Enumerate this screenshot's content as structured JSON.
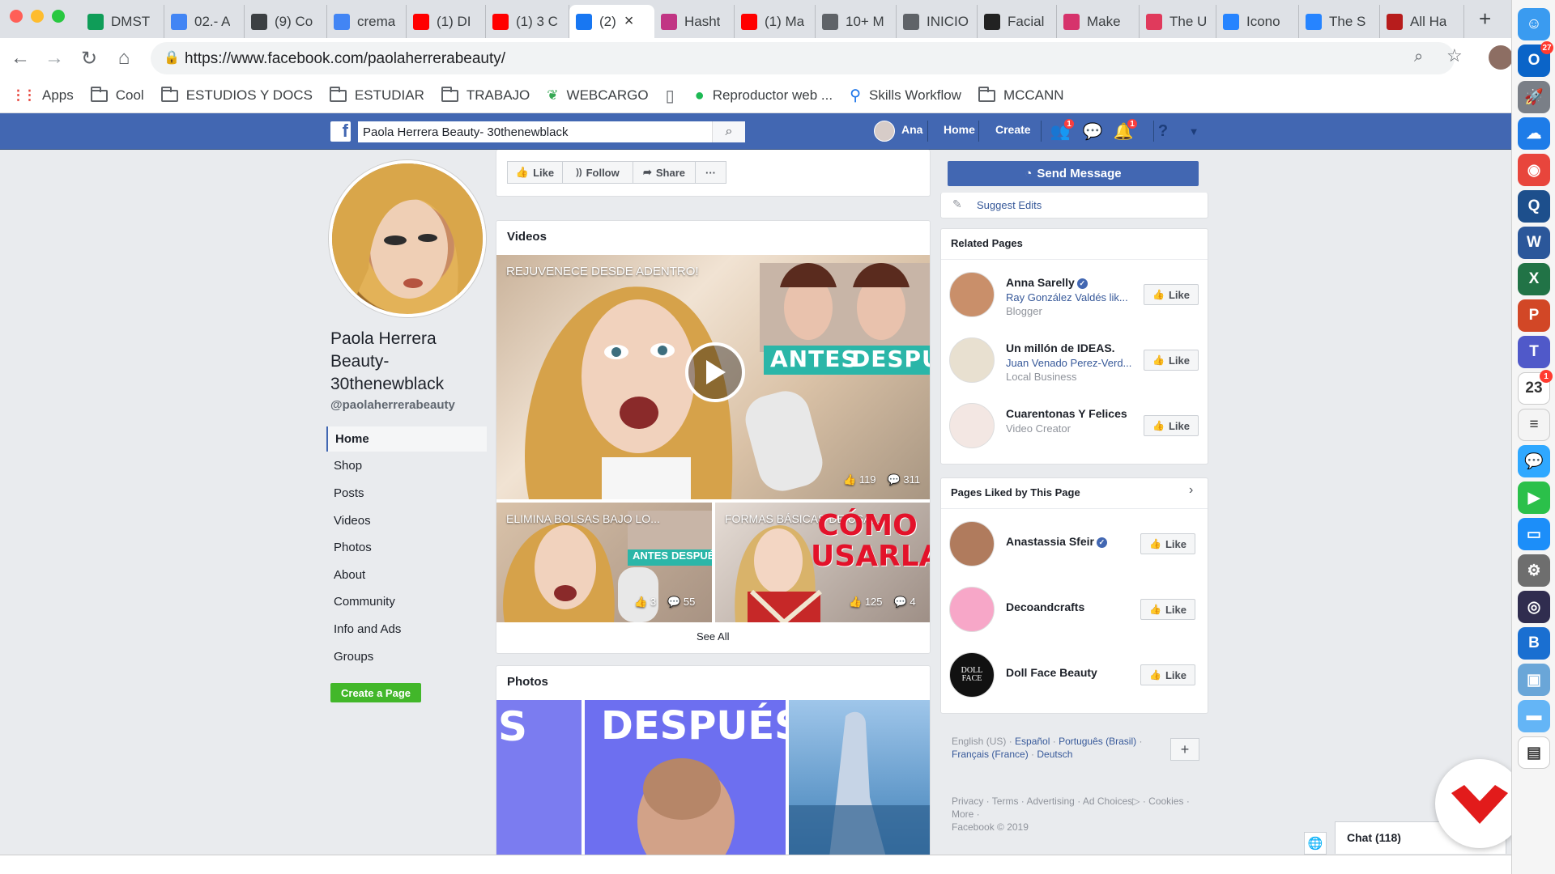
{
  "browser": {
    "tabs": [
      {
        "title": "DMST",
        "favicon": "sheets-icon",
        "color": "#0f9d58"
      },
      {
        "title": "02.- A",
        "favicon": "docs-icon",
        "color": "#4285f4"
      },
      {
        "title": "(9) Co",
        "favicon": "wordpress-icon",
        "color": "#3c4043"
      },
      {
        "title": "crema",
        "favicon": "google-icon",
        "color": "#4285f4"
      },
      {
        "title": "(1) DI",
        "favicon": "youtube-icon",
        "color": "#ff0000"
      },
      {
        "title": "(1) 3 C",
        "favicon": "youtube-icon",
        "color": "#ff0000"
      },
      {
        "title": "(2)",
        "favicon": "facebook-icon",
        "color": "#1877f2",
        "active": true
      },
      {
        "title": "Hasht",
        "favicon": "instagram-icon",
        "color": "#c13584"
      },
      {
        "title": "(1) Ma",
        "favicon": "youtube-icon",
        "color": "#ff0000"
      },
      {
        "title": "10+ M",
        "favicon": "image-icon",
        "color": "#5f6368"
      },
      {
        "title": "INICIO",
        "favicon": "page-icon",
        "color": "#5f6368"
      },
      {
        "title": "Facial",
        "favicon": "tb-icon",
        "color": "#222222"
      },
      {
        "title": "Make",
        "favicon": "makeup-icon",
        "color": "#d6336c"
      },
      {
        "title": "The U",
        "favicon": "bookmark-icon",
        "color": "#e03a5c"
      },
      {
        "title": "Icono",
        "favicon": "jira-icon",
        "color": "#2684ff"
      },
      {
        "title": "The S",
        "favicon": "jira-icon",
        "color": "#2684ff"
      },
      {
        "title": "All Ha",
        "favicon": "hashtag-icon",
        "color": "#b71c1c"
      }
    ],
    "url": "https://www.facebook.com/paolaherrerabeauty/",
    "bookmarks": [
      {
        "label": "Apps",
        "type": "apps"
      },
      {
        "label": "Cool",
        "type": "folder"
      },
      {
        "label": "ESTUDIOS Y DOCS",
        "type": "folder"
      },
      {
        "label": "ESTUDIAR",
        "type": "folder"
      },
      {
        "label": "TRABAJO",
        "type": "folder"
      },
      {
        "label": "WEBCARGO",
        "type": "leaf"
      },
      {
        "label": "",
        "type": "page"
      },
      {
        "label": "Reproductor web ...",
        "type": "spotify"
      },
      {
        "label": "Skills Workflow",
        "type": "pin"
      },
      {
        "label": "MCCANN",
        "type": "folder"
      }
    ]
  },
  "fb_header": {
    "search_value": "Paola Herrera Beauty- 30thenewblack",
    "user_name": "Ana",
    "home": "Home",
    "create": "Create",
    "friend_badge": "1",
    "notif_badge": "1"
  },
  "profile": {
    "name": "Paola Herrera Beauty- 30thenewblack",
    "handle": "@paolaherrerabeauty",
    "nav": [
      "Home",
      "Shop",
      "Posts",
      "Videos",
      "Photos",
      "About",
      "Community",
      "Info and Ads",
      "Groups"
    ],
    "create_page": "Create a Page"
  },
  "actions": {
    "like": "Like",
    "follow": "Follow",
    "share": "Share",
    "more": "···",
    "send_message": "Send Message",
    "suggest_edits": "Suggest Edits"
  },
  "videos": {
    "title": "Videos",
    "main": {
      "title": "REJUVENECE DESDE ADENTRO!",
      "overlay_antes": "ANTES",
      "overlay_despues": "DESPUÉS",
      "likes": "119",
      "comments": "311"
    },
    "small": [
      {
        "title": "ELIMINA BOLSAS BAJO LO...",
        "overlay_antes": "ANTES",
        "overlay_despues": "DESPUÉS",
        "likes": "3",
        "comments": "55"
      },
      {
        "title": "FORMAS BÁSICAS DE USA...",
        "overlay": "CÓMO USARLAS!",
        "likes": "125",
        "comments": "4"
      }
    ],
    "see_all": "See All"
  },
  "photos": {
    "title": "Photos",
    "tile_text_1": "S",
    "tile_text_2": "DESPUÉS"
  },
  "related_pages": {
    "title": "Related Pages",
    "items": [
      {
        "name": "Anna Sarelly",
        "verified": true,
        "sub": "Ray González Valdés lik...",
        "category": "Blogger"
      },
      {
        "name": "Un millón de IDEAS.",
        "verified": false,
        "sub": "Juan Venado Perez-Verd...",
        "category": "Local Business"
      },
      {
        "name": "Cuarentonas Y Felices",
        "verified": false,
        "sub": "",
        "category": "Video Creator"
      }
    ]
  },
  "liked_pages": {
    "title": "Pages Liked by This Page",
    "items": [
      {
        "name": "Anastassia Sfeir",
        "verified": true
      },
      {
        "name": "Decoandcrafts",
        "verified": false
      },
      {
        "name": "Doll Face Beauty",
        "verified": false,
        "logo_text": "DOLL FACE"
      }
    ]
  },
  "like_label": "Like",
  "footer": {
    "lang_current": "English (US)",
    "langs": [
      "Español",
      "Português (Brasil)",
      "Français (France)",
      "Deutsch"
    ],
    "add": "+",
    "links": [
      "Privacy",
      "Terms",
      "Advertising",
      "Ad Choices",
      "Cookies",
      "More"
    ],
    "copyright": "Facebook © 2019"
  },
  "chat": {
    "label": "Chat (118)"
  },
  "dock": {
    "items": [
      {
        "name": "finder-icon",
        "color": "#3a9bf0",
        "glyph": "☺"
      },
      {
        "name": "outlook-icon",
        "color": "#0a64c8",
        "glyph": "O",
        "badge": "27"
      },
      {
        "name": "launchpad-icon",
        "color": "#7a7f87",
        "glyph": "🚀"
      },
      {
        "name": "onedrive-icon",
        "color": "#1e7ce8",
        "glyph": "☁"
      },
      {
        "name": "chrome-icon",
        "color": "#e8453c",
        "glyph": "◉"
      },
      {
        "name": "quicktime-icon",
        "color": "#1d4f8c",
        "glyph": "Q"
      },
      {
        "name": "word-icon",
        "color": "#2b579a",
        "glyph": "W"
      },
      {
        "name": "excel-icon",
        "color": "#217346",
        "glyph": "X"
      },
      {
        "name": "powerpoint-icon",
        "color": "#d24726",
        "glyph": "P"
      },
      {
        "name": "teams-icon",
        "color": "#5059c9",
        "glyph": "T"
      },
      {
        "name": "calendar-icon",
        "color": "#ffffff",
        "glyph": "23",
        "badge": "1"
      },
      {
        "name": "notes-icon",
        "color": "#f4f4f4",
        "glyph": "≡"
      },
      {
        "name": "messages-icon",
        "color": "#2fa8ff",
        "glyph": "💬"
      },
      {
        "name": "facetime-icon",
        "color": "#2bc04a",
        "glyph": "▶"
      },
      {
        "name": "keynote-icon",
        "color": "#1c8ef9",
        "glyph": "▭"
      },
      {
        "name": "system-prefs-icon",
        "color": "#6e6e6e",
        "glyph": "⚙"
      },
      {
        "name": "siri-icon",
        "color": "#302d4f",
        "glyph": "◎"
      },
      {
        "name": "bbedit-icon",
        "color": "#1a6fd1",
        "glyph": "B"
      },
      {
        "name": "preview-icon",
        "color": "#6aa6d8",
        "glyph": "▣"
      },
      {
        "name": "folder-icon",
        "color": "#64b5f6",
        "glyph": "▬"
      },
      {
        "name": "doc-stack-icon",
        "color": "#ffffff",
        "glyph": "▤"
      }
    ]
  }
}
